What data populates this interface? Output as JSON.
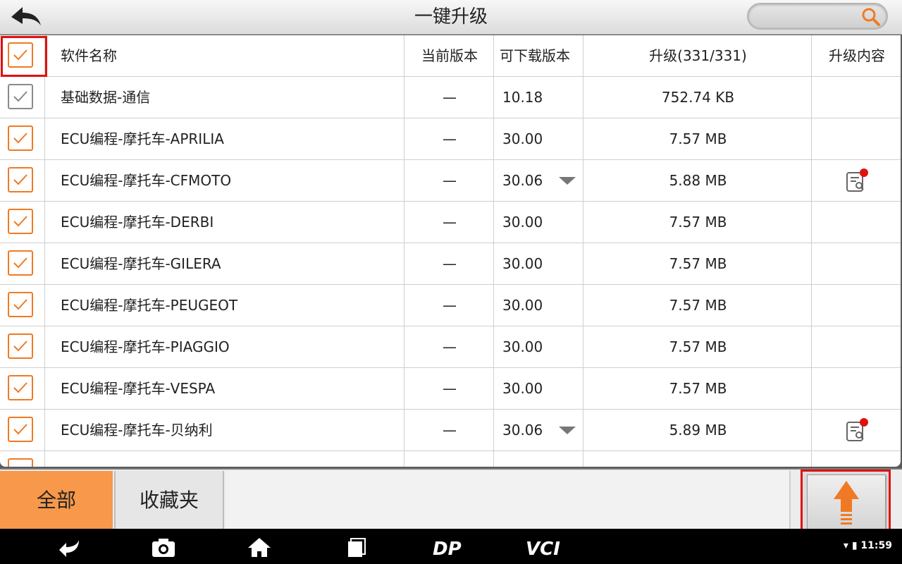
{
  "header": {
    "title": "一键升级",
    "back_icon": "back-arrow-icon",
    "search_icon": "search-icon"
  },
  "table": {
    "columns": [
      "软件名称",
      "当前版本",
      "可下载版本",
      "升级(331/331)",
      "升级内容"
    ],
    "rows": [
      {
        "name": "基础数据-通信",
        "current": "—",
        "available": "10.18",
        "size": "752.74 KB",
        "checked": true,
        "check_color": "gray",
        "dropdown": false,
        "info": false
      },
      {
        "name": "ECU编程-摩托车-APRILIA",
        "current": "—",
        "available": "30.00",
        "size": "7.57 MB",
        "checked": true,
        "check_color": "orange",
        "dropdown": false,
        "info": false
      },
      {
        "name": "ECU编程-摩托车-CFMOTO",
        "current": "—",
        "available": "30.06",
        "size": "5.88 MB",
        "checked": true,
        "check_color": "orange",
        "dropdown": true,
        "info": true
      },
      {
        "name": "ECU编程-摩托车-DERBI",
        "current": "—",
        "available": "30.00",
        "size": "7.57 MB",
        "checked": true,
        "check_color": "orange",
        "dropdown": false,
        "info": false
      },
      {
        "name": "ECU编程-摩托车-GILERA",
        "current": "—",
        "available": "30.00",
        "size": "7.57 MB",
        "checked": true,
        "check_color": "orange",
        "dropdown": false,
        "info": false
      },
      {
        "name": "ECU编程-摩托车-PEUGEOT",
        "current": "—",
        "available": "30.00",
        "size": "7.57 MB",
        "checked": true,
        "check_color": "orange",
        "dropdown": false,
        "info": false
      },
      {
        "name": "ECU编程-摩托车-PIAGGIO",
        "current": "—",
        "available": "30.00",
        "size": "7.57 MB",
        "checked": true,
        "check_color": "orange",
        "dropdown": false,
        "info": false
      },
      {
        "name": "ECU编程-摩托车-VESPA",
        "current": "—",
        "available": "30.00",
        "size": "7.57 MB",
        "checked": true,
        "check_color": "orange",
        "dropdown": false,
        "info": false
      },
      {
        "name": "ECU编程-摩托车-贝纳利",
        "current": "—",
        "available": "30.06",
        "size": "5.89 MB",
        "checked": true,
        "check_color": "orange",
        "dropdown": true,
        "info": true
      }
    ]
  },
  "bottom": {
    "tab_all": "全部",
    "tab_favorites": "收藏夹",
    "upgrade_icon": "upload-arrow-icon"
  },
  "navbar": {
    "vci_label": "VCI",
    "dp_label": "DP",
    "time": "11:59"
  },
  "colors": {
    "accent": "#f07a23",
    "tab_active": "#f7984b",
    "highlight": "#e01010"
  }
}
